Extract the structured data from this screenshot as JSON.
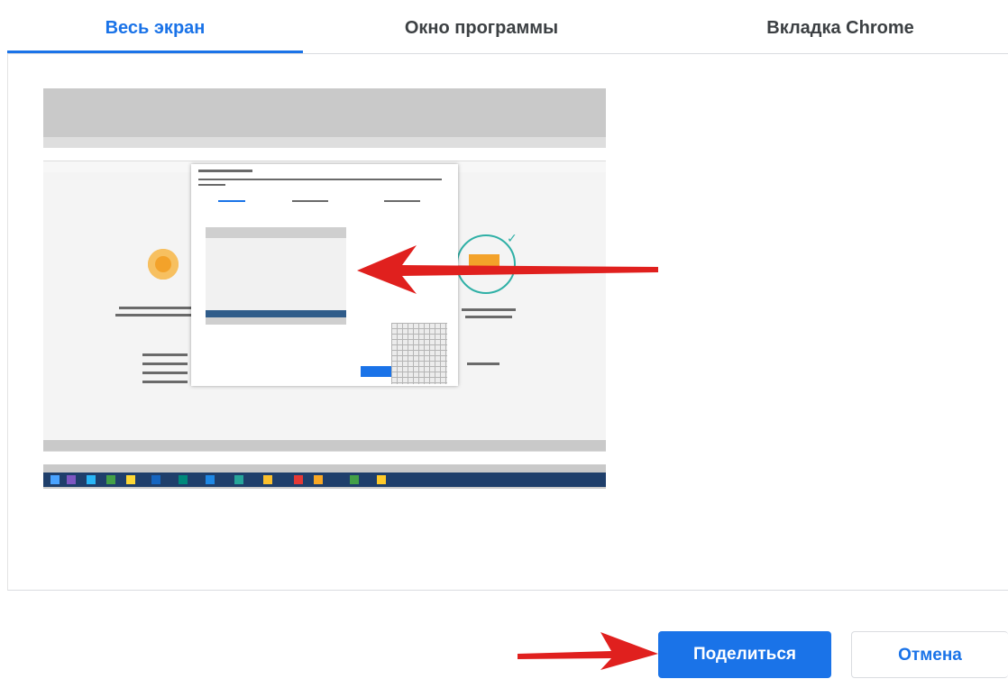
{
  "tabs": [
    {
      "label": "Весь экран",
      "active": true
    },
    {
      "label": "Окно программы",
      "active": false
    },
    {
      "label": "Вкладка Chrome",
      "active": false
    }
  ],
  "preview": {
    "icons": [
      "webcam-icon",
      "check-icon",
      "windows-start-icon"
    ]
  },
  "buttons": {
    "share_label": "Поделиться",
    "cancel_label": "Отмена"
  },
  "colors": {
    "accent": "#1a73e8",
    "arrow": "#e0201e",
    "taskbar": "#1f3f6b"
  }
}
